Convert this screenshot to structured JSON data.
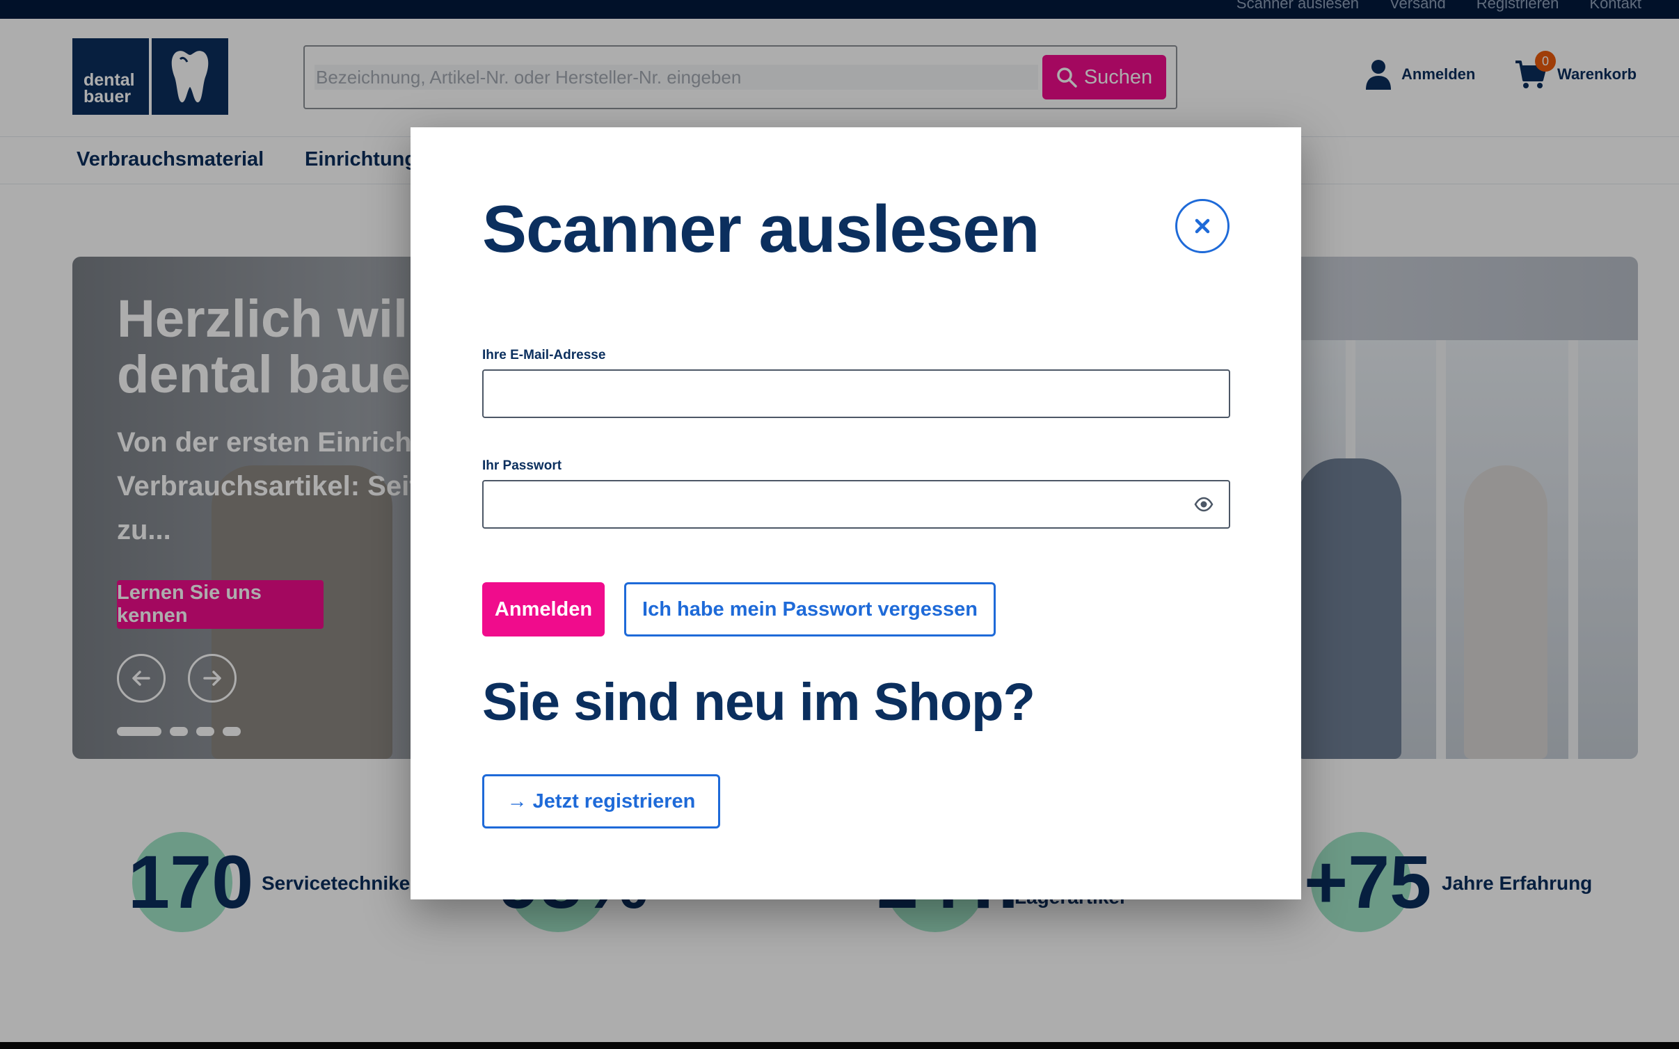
{
  "topbar": {
    "links": [
      "Scanner auslesen",
      "Versand",
      "Registrieren",
      "Kontakt"
    ]
  },
  "header": {
    "logo_line1": "dental",
    "logo_line2": "bauer",
    "search_placeholder": "Bezeichnung, Artikel-Nr. oder Hersteller-Nr. eingeben",
    "search_button": "Suchen",
    "login_label": "Anmelden",
    "cart_label": "Warenkorb",
    "cart_count": "0"
  },
  "nav": {
    "items": [
      "Verbrauchsmaterial",
      "Einrichtung"
    ]
  },
  "hero": {
    "heading": "Herzlich willkommen bei dental bauer",
    "text": "Von der ersten Einrichtung bis zum Verbrauchsartikel: Seit ... Ihnen persönlich und zu...",
    "cta": "Lernen Sie uns kennen"
  },
  "stats": [
    {
      "number": "170",
      "label": "Servicetechniker"
    },
    {
      "number": "98%",
      "label": ""
    },
    {
      "number": "24T.",
      "label": "Lagerartikel"
    },
    {
      "number": "+75",
      "label": "Jahre Erfahrung"
    }
  ],
  "modal": {
    "title": "Scanner auslesen",
    "email_label": "Ihre E-Mail-Adresse",
    "email_value": "",
    "password_label": "Ihr Passwort",
    "password_value": "",
    "login_button": "Anmelden",
    "forgot_button": "Ich habe mein Passwort vergessen",
    "new_heading": "Sie sind neu im Shop?",
    "register_button": "→ Jetzt registrieren"
  },
  "colors": {
    "brand_navy": "#0b2f5e",
    "accent_pink": "#f00c8c",
    "link_blue": "#1e6ad8",
    "stat_mint": "#9fe3c6",
    "badge_orange": "#ea5b0c"
  }
}
